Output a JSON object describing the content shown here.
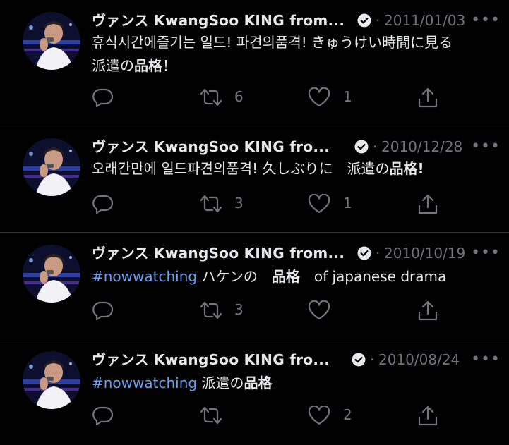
{
  "colors": {
    "background": "#000000",
    "text": "#e7e9ea",
    "muted": "#71767b",
    "hashtag": "#6a9ff0",
    "divider": "#2f3336"
  },
  "tweets": [
    {
      "name": "ヴァンス KwangSoo KING from...",
      "separator": "·",
      "date": "2011/01/03",
      "more_icon": "more-horizontal-icon",
      "text_plain": "휴식시간에즐기는 일드! 파견의품격! きゅうけい時間に見る",
      "text_line2_plain": "派遣の",
      "text_bold": "品格",
      "text_tail": "！",
      "replies": "",
      "retweets": "6",
      "likes": "1"
    },
    {
      "name": "ヴァンス KwangSoo KING fro...",
      "separator": "·",
      "date": "2010/12/28",
      "more_icon": "more-horizontal-icon",
      "text_plain": "오래간만에 일드파견의품격! 久しぶりに　派遣の",
      "text_bold": "品格!",
      "replies": "",
      "retweets": "3",
      "likes": "1"
    },
    {
      "name": "ヴァンス KwangSoo KING from...",
      "separator": "·",
      "date": "2010/10/19",
      "more_icon": "more-horizontal-icon",
      "hashtag": "#nowwatching",
      "text_plain": " ハケンの　",
      "text_bold": "品格",
      "text_tail": "　of japanese drama",
      "replies": "",
      "retweets": "3",
      "likes": ""
    },
    {
      "name": "ヴァンス KwangSoo KING fro...",
      "separator": "·",
      "date": "2010/08/24",
      "more_icon": "more-horizontal-icon",
      "hashtag": "#nowwatching",
      "text_plain": " 派遣の",
      "text_bold": "品格",
      "replies": "",
      "retweets": "",
      "likes": "2"
    }
  ]
}
